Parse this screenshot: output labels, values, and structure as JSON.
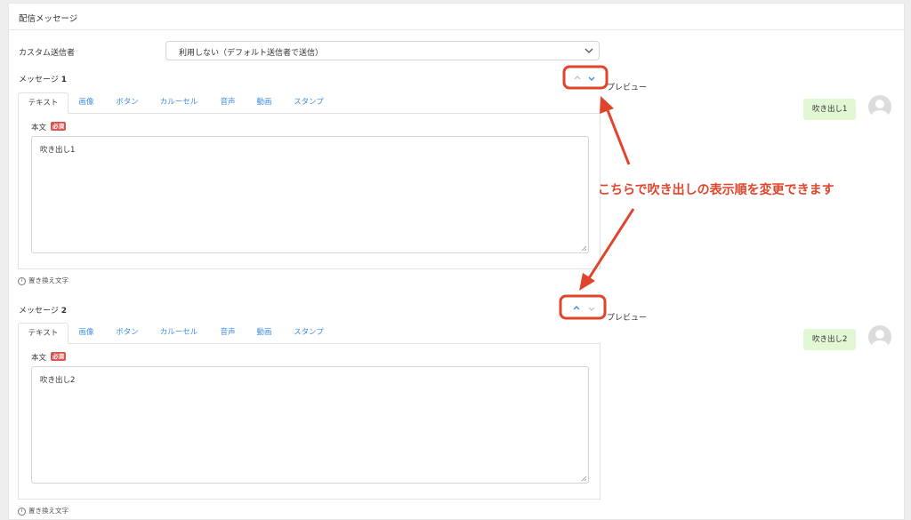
{
  "card": {
    "title": "配信メッセージ"
  },
  "custom_sender": {
    "label": "カスタム送信者",
    "selected": "利用しない（デフォルト送信者で送信）"
  },
  "messages": [
    {
      "heading_text": "メッセージ",
      "heading_num": "1",
      "tabs": [
        {
          "label": "テキスト",
          "active": true
        },
        {
          "label": "画像",
          "active": false
        },
        {
          "label": "ボタン",
          "active": false
        },
        {
          "label": "カルーセル",
          "active": false
        },
        {
          "label": "音声",
          "active": false
        },
        {
          "label": "動画",
          "active": false
        },
        {
          "label": "スタンプ",
          "active": false
        }
      ],
      "body_label": "本文",
      "required_badge": "必須",
      "body_value": "吹き出し1",
      "helper": "置き換え文字",
      "preview_label": "プレビュー",
      "preview_bubble": "吹き出し1"
    },
    {
      "heading_text": "メッセージ",
      "heading_num": "2",
      "tabs": [
        {
          "label": "テキスト",
          "active": true
        },
        {
          "label": "画像",
          "active": false
        },
        {
          "label": "ボタン",
          "active": false
        },
        {
          "label": "カルーセル",
          "active": false
        },
        {
          "label": "音声",
          "active": false
        },
        {
          "label": "動画",
          "active": false
        },
        {
          "label": "スタンプ",
          "active": false
        }
      ],
      "body_label": "本文",
      "required_badge": "必須",
      "body_value": "吹き出し2",
      "helper": "置き換え文字",
      "preview_label": "プレビュー",
      "preview_bubble": "吹き出し2"
    }
  ],
  "annotation": {
    "text": "こちらで吹き出しの表示順を変更できます"
  },
  "colors": {
    "accent": "#3f8ee6",
    "annotation": "#e0452b",
    "bubble": "#e2f7d4",
    "required": "#d9534f"
  },
  "icons": {
    "move_up": "chevron-up-icon",
    "move_down": "chevron-down-icon",
    "avatar": "user-avatar-icon",
    "info": "info-circle-icon"
  }
}
